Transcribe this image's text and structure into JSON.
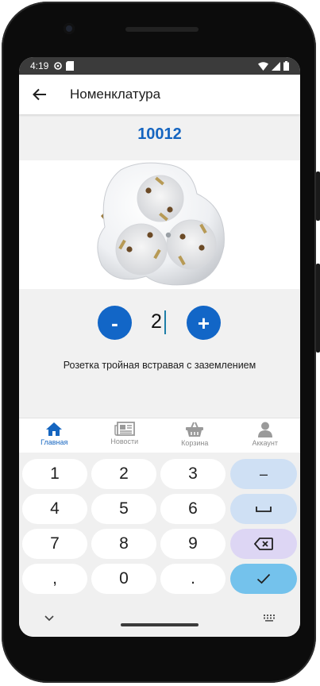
{
  "status": {
    "time": "4:19"
  },
  "appbar": {
    "title": "Номенклатура"
  },
  "product": {
    "code": "10012",
    "quantity": "2",
    "description": "Розетка тройная встравая с заземлением",
    "minus_label": "-",
    "plus_label": "+"
  },
  "bottom_nav": {
    "items": [
      {
        "label": "Главная",
        "icon": "home-icon",
        "active": true
      },
      {
        "label": "Новости",
        "icon": "newspaper-icon",
        "active": false
      },
      {
        "label": "Корзина",
        "icon": "basket-icon",
        "active": false
      },
      {
        "label": "Аккаунт",
        "icon": "person-icon",
        "active": false
      }
    ]
  },
  "keyboard": {
    "keys": [
      "1",
      "2",
      "3",
      "–",
      "4",
      "5",
      "6",
      "␣",
      "7",
      "8",
      "9",
      "⌫",
      ",",
      "0",
      ".",
      "✓"
    ]
  },
  "colors": {
    "accent": "#1565c0",
    "button": "#1266c7",
    "enter_key": "#74c2ec",
    "func_key": "#cfe0f4",
    "delete_key": "#ddd6f4"
  }
}
